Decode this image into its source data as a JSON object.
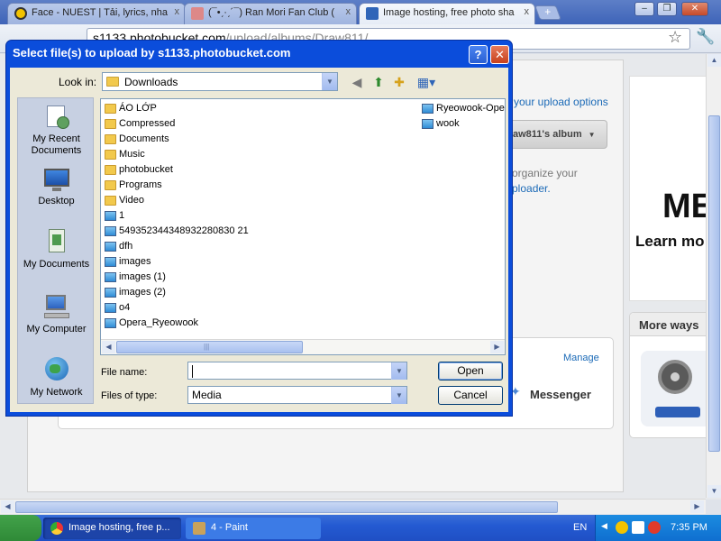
{
  "browser": {
    "tabs": [
      {
        "title": "Face - NUEST | Tải, lyrics, nha",
        "favicon": "zing-icon"
      },
      {
        "title": "(¯•ˏ·ˏ´¯) Ran Mori Fan Club (",
        "favicon": "avatar-icon"
      },
      {
        "title": "Image hosting, free photo sha",
        "favicon": "photobucket-icon"
      }
    ],
    "new_tab_label": "+",
    "close_tab_label": "x",
    "url_host": "s1133.photobucket.com",
    "url_path": "/upload/albums/Draw811/",
    "window_buttons": [
      "–",
      "❐",
      "✕"
    ]
  },
  "page": {
    "upload_options_link": "your upload options",
    "album_button": "aw811's album",
    "organize_text": "organize your",
    "uploader_link": "ploader.",
    "manage_link": "Manage",
    "messenger_label": "Messenger",
    "ad_big_text": "ME",
    "ad_learn_text": "Learn mo",
    "more_ways_heading": "More ways"
  },
  "dialog": {
    "title": "Select file(s) to upload by s1133.photobucket.com",
    "help_label": "?",
    "close_label": "✕",
    "look_in_label": "Look in:",
    "look_in_value": "Downloads",
    "places": [
      {
        "label": "My Recent Documents",
        "icon": "recent-documents-icon"
      },
      {
        "label": "Desktop",
        "icon": "desktop-icon"
      },
      {
        "label": "My Documents",
        "icon": "my-documents-icon"
      },
      {
        "label": "My Computer",
        "icon": "my-computer-icon"
      },
      {
        "label": "My Network",
        "icon": "network-icon"
      }
    ],
    "files_col1": [
      {
        "name": "ÁO LỚP",
        "type": "folder"
      },
      {
        "name": "Compressed",
        "type": "folder"
      },
      {
        "name": "Documents",
        "type": "folder"
      },
      {
        "name": "Music",
        "type": "folder"
      },
      {
        "name": "photobucket",
        "type": "folder"
      },
      {
        "name": "Programs",
        "type": "folder"
      },
      {
        "name": "Video",
        "type": "folder"
      },
      {
        "name": "1",
        "type": "image"
      },
      {
        "name": "549352344348932280830 21",
        "type": "image"
      },
      {
        "name": "dfh",
        "type": "image"
      },
      {
        "name": "images",
        "type": "image"
      },
      {
        "name": "images (1)",
        "type": "image"
      },
      {
        "name": "images (2)",
        "type": "image"
      },
      {
        "name": "o4",
        "type": "image"
      },
      {
        "name": "Opera_Ryeowook",
        "type": "image"
      }
    ],
    "files_col2": [
      {
        "name": "Ryeowook-Opera",
        "type": "image"
      },
      {
        "name": "wook",
        "type": "image"
      }
    ],
    "file_name_label": "File name:",
    "file_name_value": "",
    "files_of_type_label": "Files of type:",
    "files_of_type_value": "Media",
    "open_button": "Open",
    "cancel_button": "Cancel"
  },
  "taskbar": {
    "tasks": [
      {
        "label": "Image hosting, free p...",
        "icon": "chrome-icon"
      },
      {
        "label": "4 - Paint",
        "icon": "paint-icon"
      }
    ],
    "language": "EN",
    "clock": "7:35 PM"
  }
}
